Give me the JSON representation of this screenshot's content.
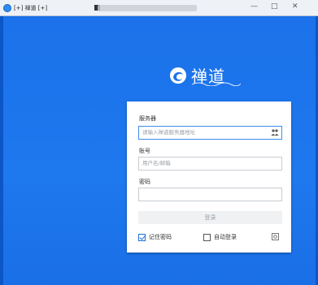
{
  "window": {
    "title": "[+] 禅道 [+]",
    "min_glyph": "—",
    "max_glyph": "□",
    "close_glyph": "✕"
  },
  "logo": {
    "text": "禅道"
  },
  "form": {
    "server_label": "服务器",
    "server_placeholder": "请输入禅道服务器地址",
    "account_label": "账号",
    "account_placeholder": "用户名/邮箱",
    "password_label": "密码",
    "password_value": "",
    "login_button": "登录",
    "remember_label": "记住密码",
    "remember_checked": true,
    "autologin_label": "自动登录",
    "autologin_checked": false
  },
  "colors": {
    "background": "#1a6fe6",
    "accent": "#3c8cf0"
  },
  "icons": [
    "app-icon",
    "peers-icon",
    "gear-icon",
    "logo-mark-icon"
  ]
}
